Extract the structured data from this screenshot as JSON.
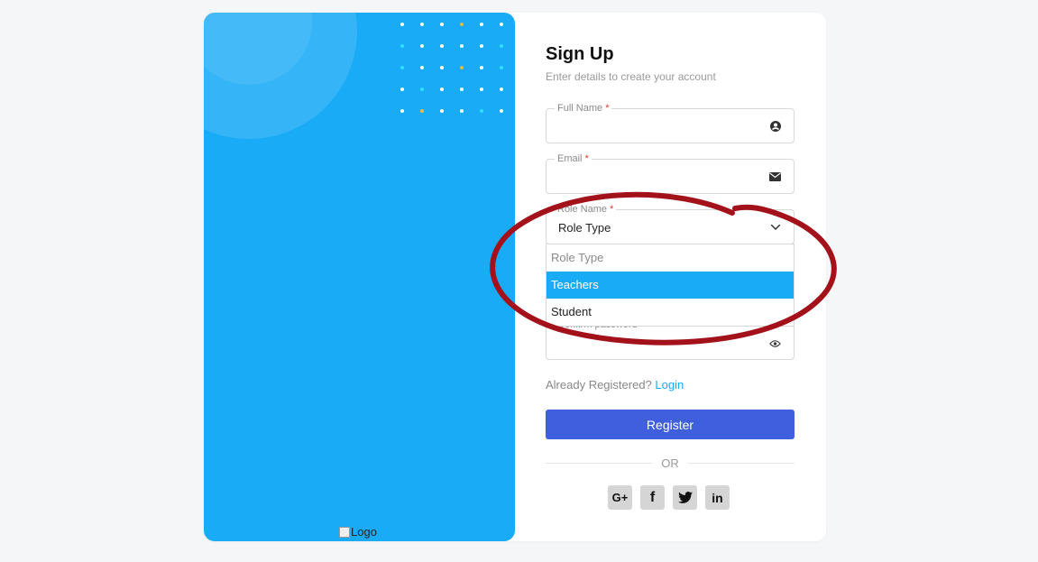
{
  "form": {
    "title": "Sign Up",
    "subtitle": "Enter details to create your account",
    "full_name_label": "Full Name",
    "email_label": "Email",
    "role_label": "Role Name",
    "role_value": "Role Type",
    "confirm_password_label": "Confirm password",
    "required_mark": "*"
  },
  "dropdown": {
    "options": [
      {
        "label": "Role Type",
        "state": "placeholder"
      },
      {
        "label": "Teachers",
        "state": "highlighted"
      },
      {
        "label": "Student",
        "state": "normal"
      }
    ]
  },
  "footer": {
    "already_text": "Already Registered?",
    "login_link": "Login",
    "register_button": "Register",
    "or_text": "OR"
  },
  "social": {
    "google": "G+",
    "facebook": "f",
    "twitter": "twitter-icon",
    "linkedin": "in"
  },
  "brand": {
    "logo_alt": "Logo"
  },
  "colors": {
    "panel_blue": "#1aabf7",
    "register_button": "#3f5fde",
    "annotation": "#a3121a"
  }
}
